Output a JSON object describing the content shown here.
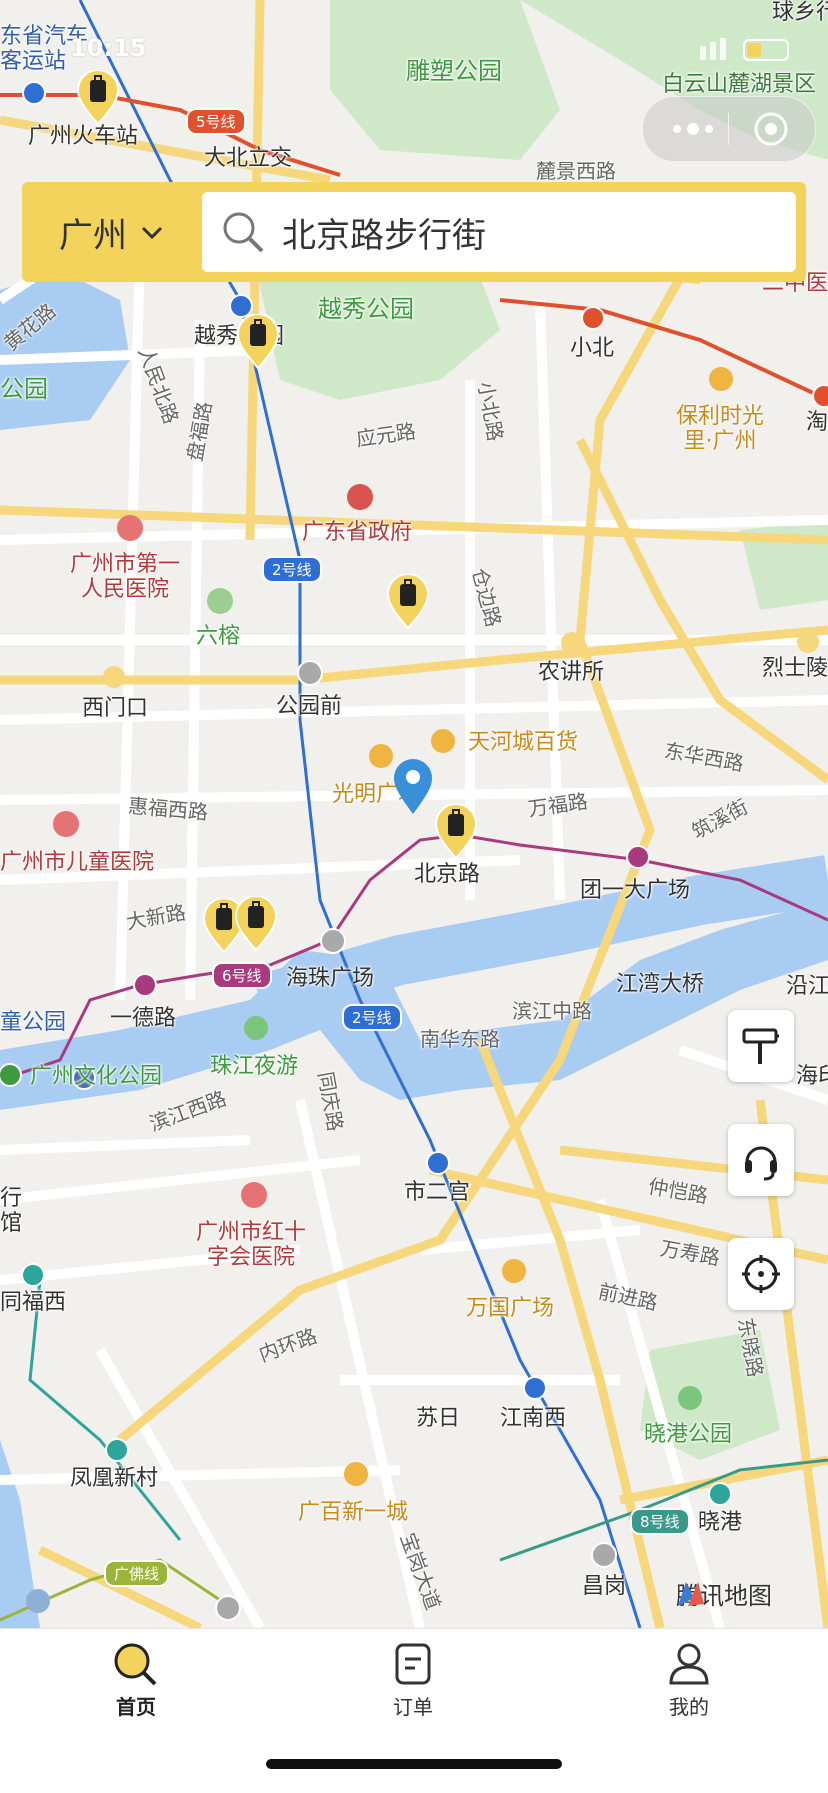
{
  "status_bar": {
    "time": "10:15"
  },
  "search": {
    "city": "广州",
    "query": "北京路步行街"
  },
  "map": {
    "provider": "腾讯地图",
    "colors": {
      "water": "#a9ccf2",
      "park": "#cfe8c8",
      "major_road": "#f6d77c",
      "metro_2": "#2f6fd4",
      "metro_6": "#a83a7e",
      "metro_5": "#e0502d",
      "accent": "#f3d35c"
    },
    "labels": {
      "park_diaosu": "雕塑公园",
      "park_yuexiu": "越秀公园",
      "park_xiaogang": "晓港公园",
      "baiyun": "白云山麓湖景区",
      "liuhua": "公园",
      "qiuxiang": "球乡行",
      "bus_station": "东省汽车\n客运站",
      "gz_railway": "广州火车站",
      "dabei": "大北立交",
      "lujing": "麓景西路",
      "xiaobei": "小北",
      "yuexiu_st": "越秀",
      "yuexiu_st2": "园",
      "poly": "保利时光\n里·广州",
      "third_hosp": "第\n二中医院",
      "hai": "淘",
      "yingyuan": "应元路",
      "xiaobei_rd": "小北路",
      "panfu": "盘福路",
      "renmin": "人民北路",
      "jiefang": "解放北路",
      "huanghua": "黄花路",
      "gov": "广东省政府",
      "hosp1": "广州市第一\n人民医院",
      "liurong": "六榕",
      "cangbian": "仓边路",
      "nongjiang": "农讲所",
      "lieshi": "烈士陵",
      "ximen": "西门口",
      "gongyuanqian": "公园前",
      "tianhe": "天河城百货",
      "guangming": "光明广场",
      "dongh": "东华西路",
      "zhuxi": "筑溪街",
      "huifu": "惠福西路",
      "wanfu": "万福路",
      "children_hosp": "广州市儿童医院",
      "beijinglu": "北京路",
      "tuanyi": "团一大广场",
      "daxin": "大新路",
      "haizhu": "海珠广场",
      "yide": "一德路",
      "jiangwan": "江湾大桥",
      "yan": "沿江",
      "binjiangzhong": "滨江中路",
      "nanhua": "南华东路",
      "tonggong": "童公园",
      "culture": "广州文化公园",
      "zhujiang": "珠江夜游",
      "binjiangxi": "滨江西路",
      "tongqing": "同庆路",
      "shierg": "市二宫",
      "zhongkai": "仲恺路",
      "wanshou": "万寿路",
      "redcross": "广州市红十\n字会医院",
      "tongfu": "同福西",
      "wanguo": "万国广场",
      "qianjin": "前进路",
      "dongxiao": "东晓路",
      "neihuan": "内环路",
      "suri": "苏日",
      "jiangnanxi": "江南西",
      "fenghuang": "凤凰新村",
      "guangbai": "广百新一城",
      "xiaogang": "晓港",
      "changgang": "昌岗",
      "baogang": "宝岗大道",
      "hangz": "海印",
      "left_edge": "行\n馆"
    },
    "metro_badges": {
      "line5": "5号线",
      "line2a": "2号线",
      "line6": "6号线",
      "line2b": "2号线",
      "line8": "8号线",
      "guangfo": "广佛线"
    }
  },
  "tabs": [
    {
      "label": "首页",
      "active": true
    },
    {
      "label": "订单",
      "active": false
    },
    {
      "label": "我的",
      "active": false
    }
  ]
}
